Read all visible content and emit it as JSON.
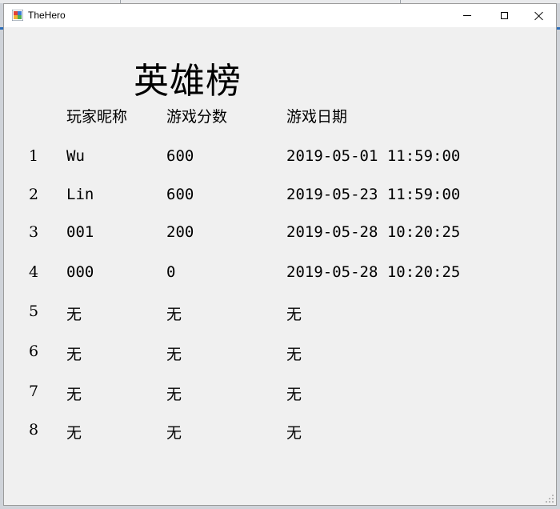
{
  "window": {
    "title": "TheHero",
    "controls": [
      "minimize",
      "maximize",
      "close"
    ]
  },
  "board": {
    "heading": "英雄榜",
    "columns": [
      "玩家昵称",
      "游戏分数",
      "游戏日期"
    ],
    "rows": [
      {
        "rank": "1",
        "name": "Wu",
        "score": "600",
        "date": "2019-05-01 11:59:00"
      },
      {
        "rank": "2",
        "name": "Lin",
        "score": "600",
        "date": "2019-05-23 11:59:00"
      },
      {
        "rank": "3",
        "name": "001",
        "score": "200",
        "date": "2019-05-28 10:20:25"
      },
      {
        "rank": "4",
        "name": "000",
        "score": "0",
        "date": "2019-05-28 10:20:25"
      },
      {
        "rank": "5",
        "name": "无",
        "score": "无",
        "date": "无"
      },
      {
        "rank": "6",
        "name": "无",
        "score": "无",
        "date": "无"
      },
      {
        "rank": "7",
        "name": "无",
        "score": "无",
        "date": "无"
      },
      {
        "rank": "8",
        "name": "无",
        "score": "无",
        "date": "无"
      }
    ]
  }
}
